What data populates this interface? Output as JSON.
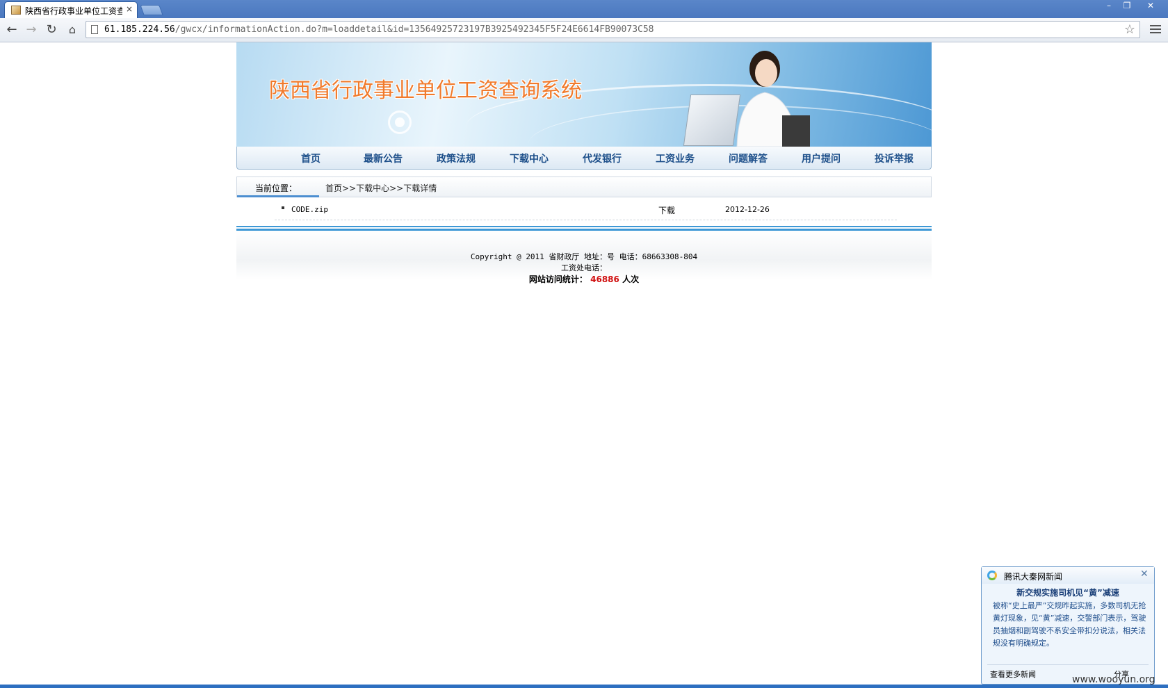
{
  "browser": {
    "tab_title": "陕西省行政事业单位工资查询系",
    "tab_close": "×",
    "url_host": "61.185.224.56",
    "url_path": "/gwcx/informationAction.do?m=loaddetail&id=13564925723197B3925492345F5F24E6614FB90073C58",
    "win_min": "–",
    "win_restore": "❐",
    "win_close": "✕"
  },
  "site": {
    "banner_title": "陕西省行政事业单位工资查询系统",
    "nav": [
      "首页",
      "最新公告",
      "政策法规",
      "下载中心",
      "代发银行",
      "工资业务",
      "问题解答",
      "用户提问",
      "投诉举报"
    ],
    "breadcrumb_label": "当前位置：",
    "breadcrumb_path": "首页>>下载中心>>下载详情",
    "file": {
      "name": "CODE.zip",
      "download_label": "下载",
      "date": "2012-12-26"
    },
    "footer": {
      "line1": "Copyright @ 2011  省财政厅 地址：号 电话：68663308-804",
      "line2": "工资处电话：",
      "visit_label": "网站访问统计：",
      "visit_count": "46886",
      "visit_unit": "人次"
    }
  },
  "popup": {
    "brand": "腾讯大秦网新闻",
    "close": "✕",
    "headline": "新交规实施司机见“黄”减速",
    "body": "被称“史上最严”交规昨起实施，多数司机无抢黄灯现象，见“黄”减速，交警部门表示，驾驶员抽烟和副驾驶不系安全带扣分说法，相关法规没有明确规定。",
    "more": "查看更多新闻",
    "share": "分享"
  },
  "watermark": "www.wooyun.org"
}
